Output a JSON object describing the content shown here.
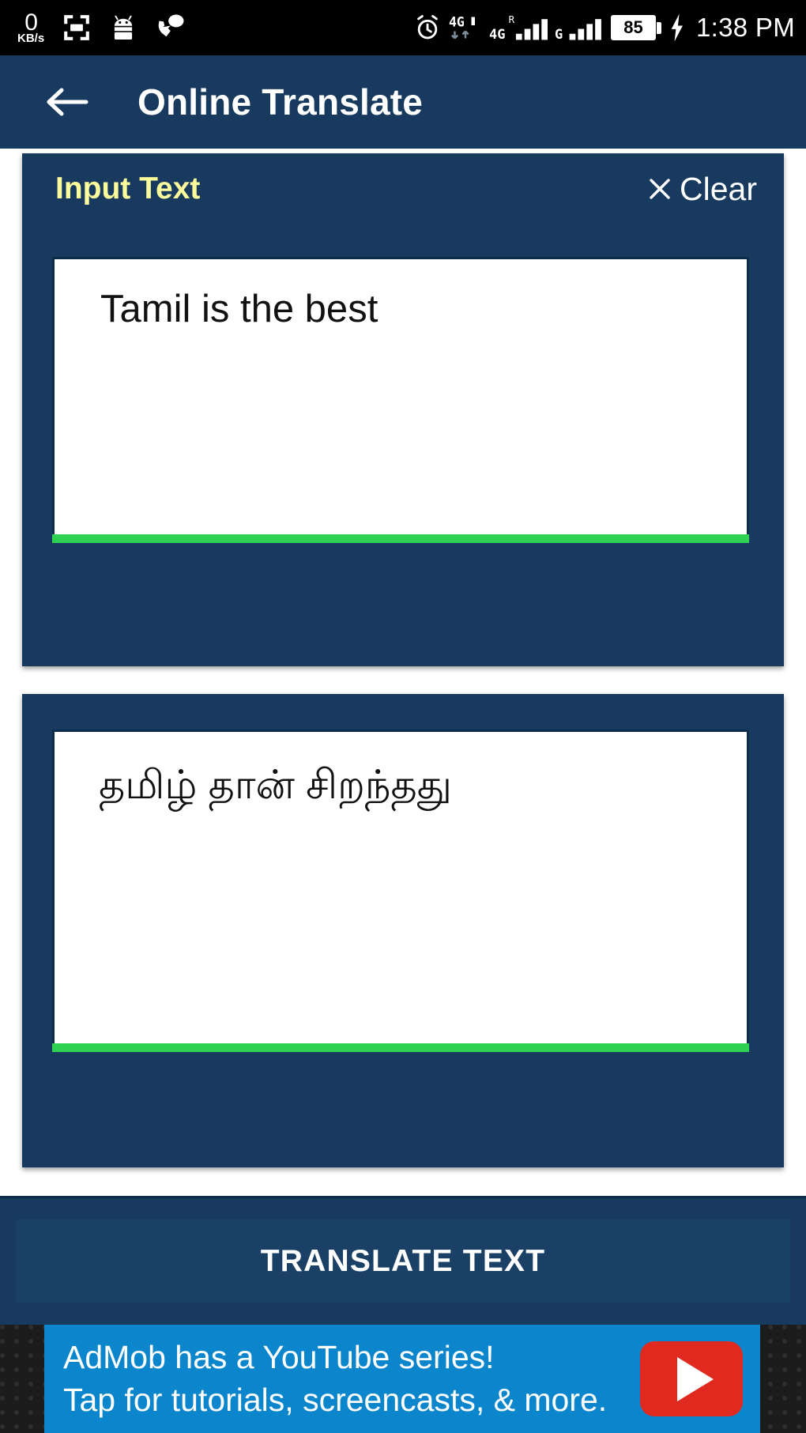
{
  "status_bar": {
    "network_speed_value": "0",
    "network_speed_unit": "KB/s",
    "icons_left": [
      "screenshot-crop-icon",
      "android-robot-icon",
      "phone-call-bubble-icon"
    ],
    "alarm_icon": "alarm-clock-icon",
    "data_icon_label": "4G",
    "sim1_label": "4G",
    "sim1_roaming_label": "R",
    "sim2_label": "G",
    "battery_percent": "85",
    "charging_icon": "charging-bolt-icon",
    "time": "1:38 PM"
  },
  "app_bar": {
    "back_icon": "back-arrow-icon",
    "title": "Online Translate"
  },
  "input_card": {
    "label": "Input Text",
    "clear_icon": "close-x-icon",
    "clear_label": "Clear",
    "text_value": "Tamil is the best",
    "underline_color": "#2fd152"
  },
  "output_card": {
    "text_value": "தமிழ் தான் சிறந்தது",
    "underline_color": "#2fd152"
  },
  "bottom_bar": {
    "translate_label": "TRANSLATE TEXT"
  },
  "ad": {
    "line1": "AdMob has a YouTube series!",
    "line2": "Tap for tutorials, screencasts, & more.",
    "badge_icon": "youtube-play-icon",
    "background_color": "#0b86cd",
    "badge_color": "#e02a20"
  },
  "theme": {
    "navy": "#173a5e",
    "yellow": "#fbfb9c",
    "green": "#2fd152"
  }
}
